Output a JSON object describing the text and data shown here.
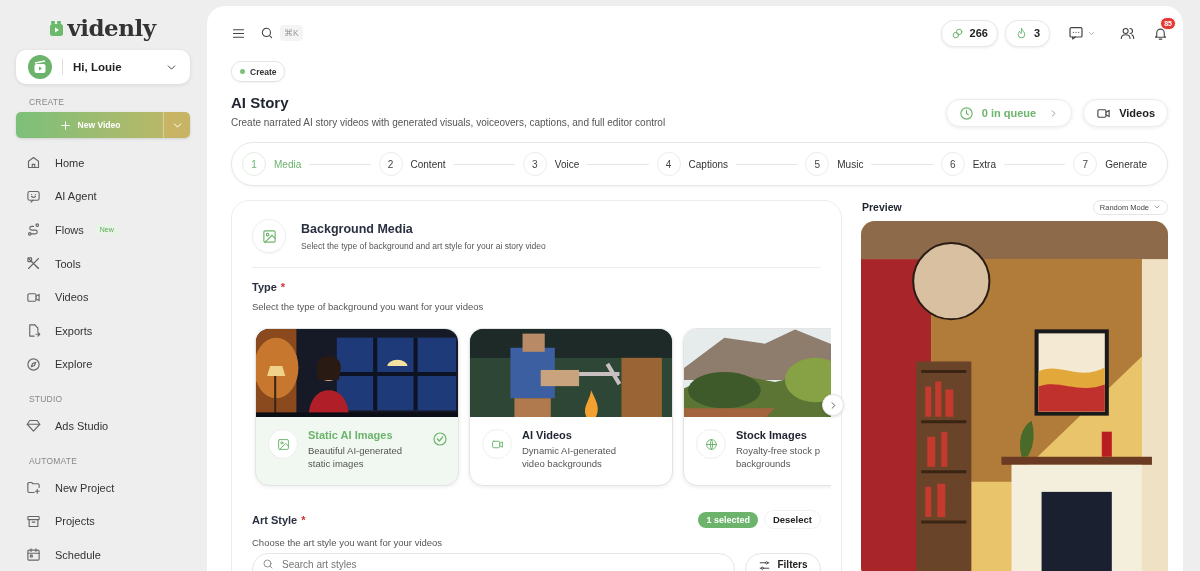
{
  "sidebar": {
    "logo": "videnly",
    "user_menu": {
      "label": "Hi, Louie"
    },
    "sections": [
      {
        "heading": "CREATE",
        "button": "New Video",
        "items": [
          {
            "label": "Home",
            "selected": false
          },
          {
            "label": "AI Agent",
            "selected": false
          },
          {
            "label": "Flows",
            "badge": "New",
            "selected": false
          },
          {
            "label": "Tools",
            "selected": false
          },
          {
            "label": "Videos",
            "selected": false
          },
          {
            "label": "Exports",
            "selected": false
          },
          {
            "label": "Explore",
            "selected": false
          }
        ]
      },
      {
        "heading": "STUDIO",
        "items": [
          {
            "label": "Ads Studio",
            "selected": false
          }
        ]
      },
      {
        "heading": "AUTOMATE",
        "items": [
          {
            "label": "New Project",
            "selected": false
          },
          {
            "label": "Projects",
            "selected": false
          },
          {
            "label": "Schedule",
            "selected": false
          }
        ]
      }
    ]
  },
  "topbar": {
    "search_shortcut": "⌘K",
    "credits": "266",
    "streak": "3",
    "notifications": "85"
  },
  "header": {
    "chip": "Create",
    "title": "AI Story",
    "subtitle": "Create narrated AI story videos with generated visuals, voiceovers, captions, and full editor control",
    "queue_button": "0 in queue",
    "videos_button": "Videos"
  },
  "steps": [
    {
      "number": "1",
      "label": "Media",
      "selected": true
    },
    {
      "number": "2",
      "label": "Content",
      "selected": false
    },
    {
      "number": "3",
      "label": "Voice",
      "selected": false
    },
    {
      "number": "4",
      "label": "Captions",
      "selected": false
    },
    {
      "number": "5",
      "label": "Music",
      "selected": false
    },
    {
      "number": "6",
      "label": "Extra",
      "selected": false
    },
    {
      "number": "7",
      "label": "Generate",
      "selected": false
    }
  ],
  "background_media": {
    "title": "Background Media",
    "subtitle": "Select the type of background and art style for your ai story video",
    "type_label": "Type",
    "type_required": "*",
    "type_hint": "Select the type of background you want for your videos",
    "types": [
      {
        "kind": "images",
        "title": "Static AI Images",
        "description": [
          "Beautiful AI-generated",
          "static images"
        ],
        "selected": true
      },
      {
        "kind": "videos",
        "title": "AI Videos",
        "description": [
          "Dynamic AI-generated",
          "video backgrounds"
        ],
        "selected": false
      },
      {
        "kind": "stock",
        "title": "Stock Images",
        "description": [
          "Royalty-free stock p",
          "backgrounds"
        ],
        "selected": false
      }
    ],
    "art_style": {
      "label": "Art Style",
      "required": "*",
      "hint": "Choose the art style you want for your videos",
      "selected_count": "1 selected",
      "deselect": "Deselect",
      "search_placeholder": "Search art styles",
      "filters": "Filters"
    }
  },
  "preview": {
    "title": "Preview",
    "mode": "Random Mode"
  }
}
